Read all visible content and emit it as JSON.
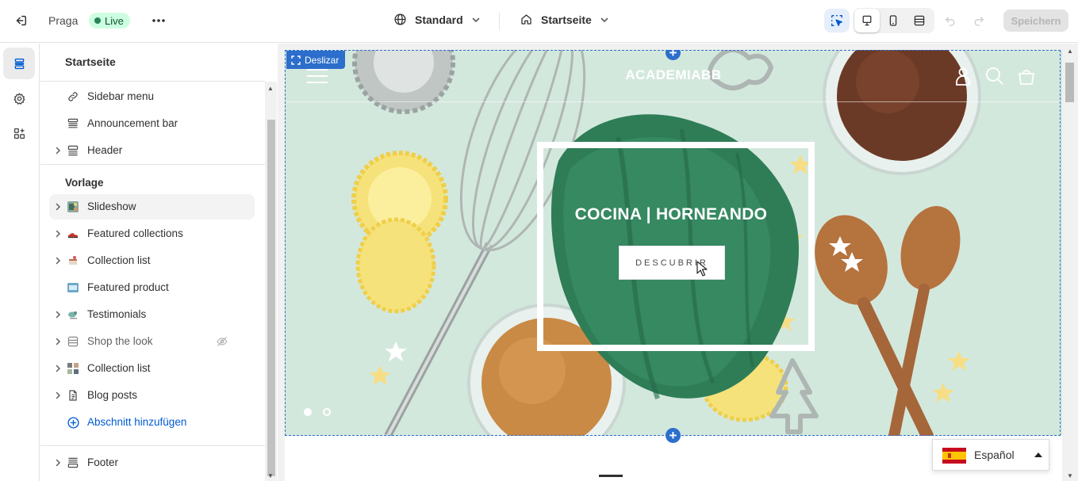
{
  "topbar": {
    "store_name": "Praga",
    "status_badge": "Live",
    "more_label": "•••",
    "theme_select": "Standard",
    "page_select": "Startseite",
    "save_label": "Speichern"
  },
  "sidebar": {
    "title": "Startseite",
    "header_items": [
      {
        "label": "Sidebar menu",
        "icon": "link-icon"
      },
      {
        "label": "Announcement bar",
        "icon": "announcement-icon"
      },
      {
        "label": "Header",
        "icon": "header-layout-icon"
      }
    ],
    "template_group": "Vorlage",
    "template_items": [
      {
        "label": "Slideshow",
        "icon": "slideshow-thumb-icon"
      },
      {
        "label": "Featured collections",
        "icon": "shoe-thumb-icon"
      },
      {
        "label": "Collection list",
        "icon": "cake-thumb-icon"
      },
      {
        "label": "Featured product",
        "icon": "product-thumb-icon"
      },
      {
        "label": "Testimonials",
        "icon": "bird-thumb-icon"
      },
      {
        "label": "Shop the look",
        "icon": "layout-icon"
      },
      {
        "label": "Collection list",
        "icon": "collection-thumb-icon"
      },
      {
        "label": "Blog posts",
        "icon": "blog-icon"
      }
    ],
    "add_section": "Abschnitt hinzufügen",
    "footer_item": "Footer"
  },
  "preview": {
    "section_tag": "Deslizar",
    "logo": "ACADEMIABB",
    "heading": "COCINA | HORNEANDO",
    "button": "DESCUBRIR",
    "slide_count": 2,
    "active_slide": 1,
    "language": "Español"
  },
  "colors": {
    "accent": "#2c6ecb",
    "live_badge_bg": "#cdfee1",
    "live_dot": "#29845a",
    "link_blue": "#005bd3",
    "hero_bg": "#d3e8dd",
    "brush_green": "#2e7d57"
  }
}
